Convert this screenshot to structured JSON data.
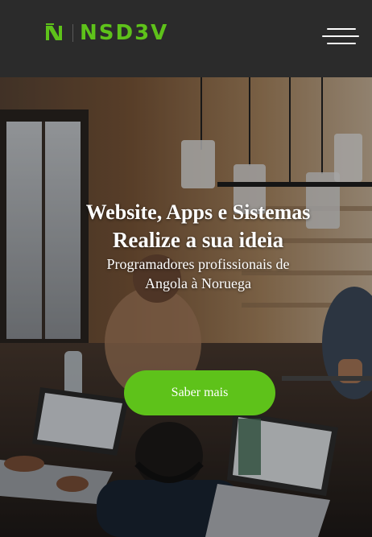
{
  "brand": {
    "name": "NSD3V",
    "accent_color": "#5ec21a",
    "mark_icon": "nsdev-logo-icon"
  },
  "navbar": {
    "menu_icon": "hamburger-menu-icon"
  },
  "hero": {
    "title": "Website, Apps e Sistemas",
    "subtitle": "Realize a sua ideia",
    "description": "Programadores profissionais de Angola à Noruega",
    "cta_label": "Saber mais"
  }
}
